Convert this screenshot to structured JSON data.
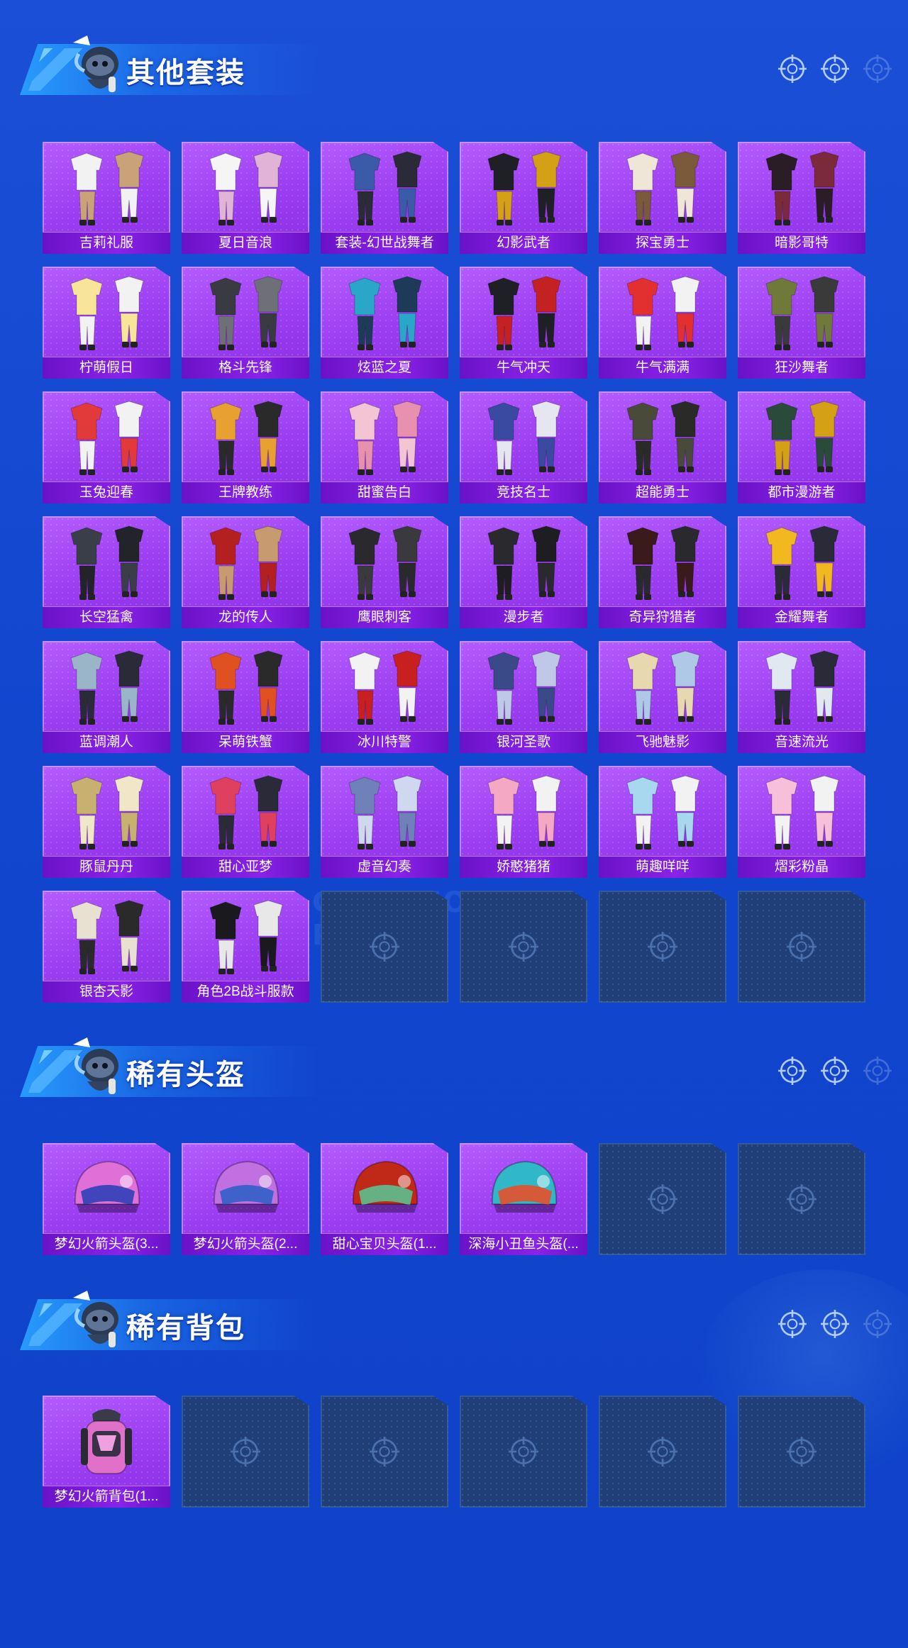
{
  "colors": {
    "page_bg": "#1246cf",
    "card_purple": "#9a3cf0",
    "label_purple": "#7a1ad8",
    "empty_slot": "#203f79",
    "banner_cyan": "#28a0ff"
  },
  "sections": [
    {
      "title": "其他套装",
      "header_icons": [
        "crosshair-icon",
        "crosshair-icon",
        "crosshair-icon-faded"
      ],
      "items": [
        "吉莉礼服",
        "夏日音浪",
        "套装-幻世战舞者",
        "幻影武者",
        "探宝勇士",
        "暗影哥特",
        "柠萌假日",
        "格斗先锋",
        "炫蓝之夏",
        "牛气冲天",
        "牛气满满",
        "狂沙舞者",
        "玉兔迎春",
        "王牌教练",
        "甜蜜告白",
        "竞技名士",
        "超能勇士",
        "都市漫游者",
        "长空猛禽",
        "龙的传人",
        "鹰眼刺客",
        "漫步者",
        "奇异狩猎者",
        "金耀舞者",
        "蓝调潮人",
        "呆萌铁蟹",
        "冰川特警",
        "银河圣歌",
        "飞驰魅影",
        "音速流光",
        "豚鼠丹丹",
        "甜心亚梦",
        "虚音幻奏",
        "娇憨猪猪",
        "萌趣咩咩",
        "熠彩粉晶",
        "银杏天影",
        "角色2B战斗服款"
      ],
      "empty_slots": 4
    },
    {
      "title": "稀有头盔",
      "header_icons": [
        "crosshair-icon",
        "crosshair-icon",
        "crosshair-icon-faded"
      ],
      "items": [
        "梦幻火箭头盔(3...",
        "梦幻火箭头盔(2...",
        "甜心宝贝头盔(1...",
        "深海小丑鱼头盔(..."
      ],
      "empty_slots": 2
    },
    {
      "title": "稀有背包",
      "header_icons": [
        "crosshair-icon",
        "crosshair-icon",
        "crosshair-icon-faded"
      ],
      "items": [
        "梦幻火箭背包(1..."
      ],
      "empty_slots": 5
    }
  ],
  "watermark": "GAME FOR PEACE"
}
